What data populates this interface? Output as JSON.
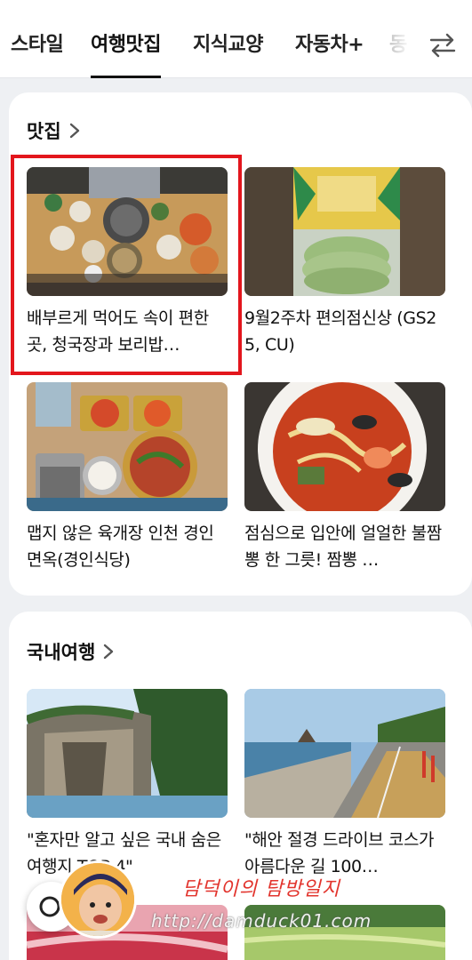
{
  "tabs": [
    {
      "label": "스타일"
    },
    {
      "label": "여행맛집"
    },
    {
      "label": "지식교양"
    },
    {
      "label": "자동차+"
    },
    {
      "label": "동"
    }
  ],
  "active_tab": "여행맛집",
  "sections": [
    {
      "title": "맛집",
      "items": [
        {
          "title": "배부르게 먹어도 속이 편한 곳, 청국장과 보리밥…",
          "thumb": "korean-meal-table"
        },
        {
          "title": "9월2주차 편의점신상 (GS25, CU)",
          "thumb": "macaron-package"
        },
        {
          "title": "맵지 않은 육개장 인천 경인면옥(경인식당)",
          "thumb": "yukgaejang-set"
        },
        {
          "title": "점심으로 입안에 얼얼한 불짬뽕 한 그릇! 짬뽕 …",
          "thumb": "jjamppong-bowl"
        }
      ]
    },
    {
      "title": "국내여행",
      "items": [
        {
          "title": "\"혼자만 알고 싶은 국내 숨은 여행지 TOP 4\"",
          "thumb": "sea-cliff"
        },
        {
          "title": "\"해안 절경 드라이브 코스가 아름다운 길 100…",
          "thumb": "coastal-road"
        }
      ]
    }
  ],
  "watermark": {
    "name": "담덕이의 탐방일지",
    "url": "http://damduck01.com"
  }
}
